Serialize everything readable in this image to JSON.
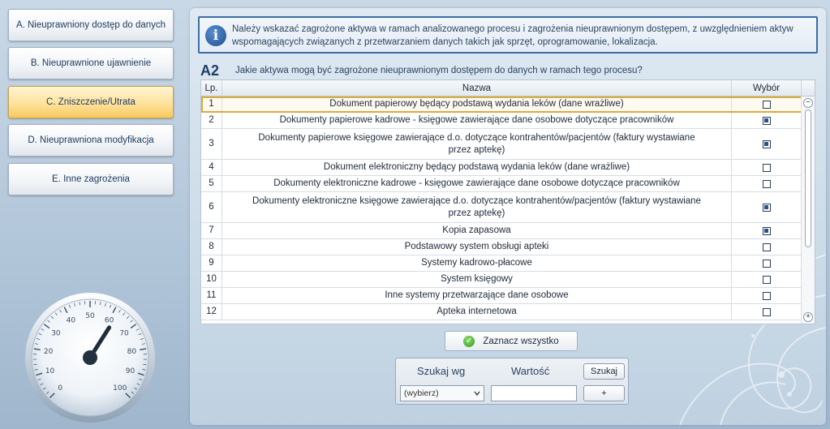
{
  "nav": {
    "items": [
      {
        "label": "A. Nieuprawniony dostęp do danych",
        "active": false
      },
      {
        "label": "B. Nieuprawnione ujawnienie",
        "active": false
      },
      {
        "label": "C. Zniszczenie/Utrata",
        "active": true
      },
      {
        "label": "D. Nieuprawniona modyfikacja",
        "active": false
      },
      {
        "label": "E. Inne zagrożenia",
        "active": false
      }
    ]
  },
  "gauge": {
    "ticks": [
      "0",
      "10",
      "20",
      "30",
      "40",
      "50",
      "60",
      "70",
      "80",
      "90",
      "100"
    ],
    "value": 62
  },
  "info": {
    "text": "Należy wskazać zagrożone aktywa w ramach analizowanego procesu i zagrożenia nieuprawnionym dostępem, z uwzględnieniem aktyw wspomagających związanych z przetwarzaniem danych takich jak sprzęt, oprogramowanie, lokalizacja."
  },
  "section": {
    "code": "A2",
    "question": "Jakie aktywa mogą być zagrożone nieuprawnionym dostępem do danych w ramach tego procesu?"
  },
  "table": {
    "headers": {
      "lp": "Lp.",
      "name": "Nazwa",
      "select": "Wybór"
    },
    "rows": [
      {
        "lp": "1",
        "name": "Dokument papierowy będący podstawą wydania leków (dane wrażliwe)",
        "checked": false
      },
      {
        "lp": "2",
        "name": "Dokumenty papierowe kadrowe - księgowe zawierające dane osobowe  dotyczące pracowników",
        "checked": true
      },
      {
        "lp": "3",
        "name": "Dokumenty papierowe księgowe zawierające d.o. dotyczące kontrahentów/pacjentów (faktury wystawiane przez aptekę)",
        "checked": true
      },
      {
        "lp": "4",
        "name": "Dokument elektroniczny będący podstawą wydania leków (dane wrażliwe)",
        "checked": false
      },
      {
        "lp": "5",
        "name": "Dokumenty elektroniczne kadrowe - księgowe zawierające dane osobowe  dotyczące pracowników",
        "checked": false
      },
      {
        "lp": "6",
        "name": "Dokumenty elektroniczne księgowe zawierające d.o. dotyczące kontrahentów/pacjentów (faktury wystawiane przez aptekę)",
        "checked": true
      },
      {
        "lp": "7",
        "name": "Kopia zapasowa",
        "checked": true
      },
      {
        "lp": "8",
        "name": "Podstawowy system obsługi apteki",
        "checked": false
      },
      {
        "lp": "9",
        "name": "Systemy kadrowo-płacowe",
        "checked": false
      },
      {
        "lp": "10",
        "name": "System księgowy",
        "checked": false
      },
      {
        "lp": "11",
        "name": "Inne systemy przetwarzające dane osobowe",
        "checked": false
      },
      {
        "lp": "12",
        "name": "Apteka internetowa",
        "checked": false
      }
    ]
  },
  "actions": {
    "mark_all": "Zaznacz wszystko"
  },
  "search": {
    "by_label": "Szukaj wg",
    "value_label": "Wartość",
    "search_button": "Szukaj",
    "add_button": "+",
    "select_value": "(wybierz)",
    "input_value": ""
  },
  "colors": {
    "accent": "#3a6ea5",
    "active_tab": "#f6c95e",
    "checked": "#2a4f8a"
  }
}
